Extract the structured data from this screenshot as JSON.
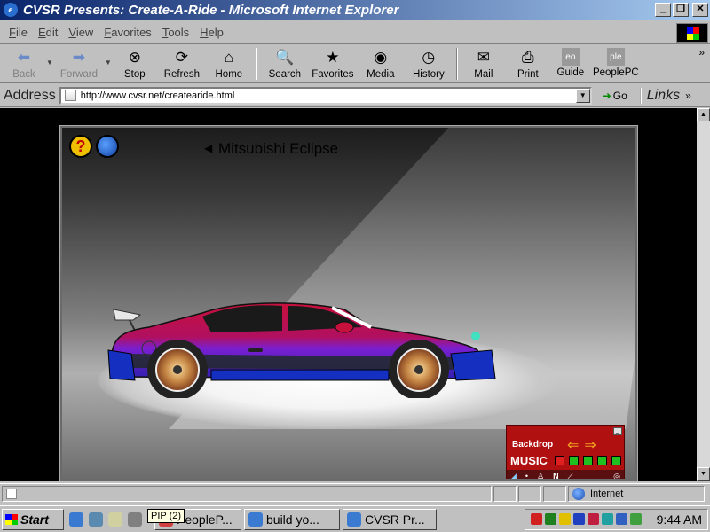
{
  "window": {
    "title": "CVSR Presents: Create-A-Ride - Microsoft Internet Explorer"
  },
  "menu": [
    "File",
    "Edit",
    "View",
    "Favorites",
    "Tools",
    "Help"
  ],
  "toolbar": {
    "back": "Back",
    "forward": "Forward",
    "stop": "Stop",
    "refresh": "Refresh",
    "home": "Home",
    "search": "Search",
    "favorites": "Favorites",
    "media": "Media",
    "history": "History",
    "mail": "Mail",
    "print": "Print",
    "guide": "Guide",
    "peoplepc": "PeoplePC",
    "guide_icon": "eo",
    "peoplepc_icon": "ple"
  },
  "address": {
    "label": "Address",
    "url": "http://www.cvsr.net/createaride.html",
    "go": "Go",
    "links": "Links"
  },
  "flash": {
    "help_symbol": "?",
    "car_name": "Mitsubishi Eclipse",
    "panel": {
      "backdrop_label": "Backdrop",
      "music_label": "MUSIC",
      "n_label": "N",
      "min_symbol": "_"
    },
    "colors": {
      "car_red": "#c8103c",
      "car_purple": "#7a1fd0",
      "car_blue": "#1530c0",
      "panel_red": "#b01010"
    }
  },
  "status": {
    "zone": "Internet"
  },
  "taskbar": {
    "start": "Start",
    "tooltip": "PIP (2)",
    "tasks": [
      "PeopleP...",
      "build yo...",
      "CVSR Pr..."
    ],
    "clock": "9:44 AM"
  }
}
